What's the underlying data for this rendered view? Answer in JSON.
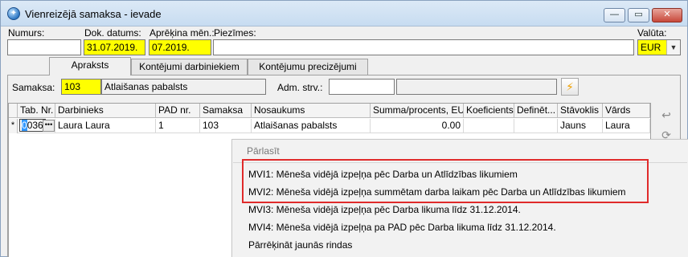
{
  "window": {
    "title": "Vienreizējā samaksa - ievade",
    "controls": {
      "minimize": "—",
      "maximize": "▭",
      "close": "✕"
    }
  },
  "header_fields": {
    "numurs": {
      "label": "Numurs:",
      "value": ""
    },
    "dok_datums": {
      "label": "Dok. datums:",
      "value": "31.07.2019."
    },
    "aprekina_men": {
      "label": "Aprēķina mēn.:",
      "value": "07.2019."
    },
    "piezimes": {
      "label": "Piezīmes:",
      "value": ""
    },
    "valuta": {
      "label": "Valūta:",
      "value": "EUR"
    }
  },
  "tabs": [
    {
      "label": "Apraksts",
      "active": true
    },
    {
      "label": "Kontējumi darbiniekiem",
      "active": false
    },
    {
      "label": "Kontējumu precizējumi",
      "active": false
    }
  ],
  "samaksa": {
    "label": "Samaksa:",
    "code": "103",
    "name": "Atlaišanas pabalsts",
    "adm_label": "Adm. strv.:",
    "adm_code": "",
    "adm_name": ""
  },
  "grid": {
    "columns": [
      "Tab. Nr.",
      "Darbinieks",
      "PAD nr.",
      "Samaksa",
      "Nosaukums",
      "Summa/procents, EUR",
      "Koeficients",
      "Definēt...",
      "Stāvoklis",
      "Vārds"
    ],
    "rows": [
      {
        "indicator": "*",
        "tab_nr": "0036",
        "tab_nr_selected": "0",
        "tab_nr_rest": "036",
        "darbinieks": "Laura Laura",
        "pad_nr": "1",
        "samaksa": "103",
        "nosaukums": "Atlaišanas pabalsts",
        "summa": "0.00",
        "koeficients": "",
        "definet": "",
        "stavoklis": "Jauns",
        "vards": "Laura"
      }
    ]
  },
  "context_menu": {
    "header": "Pārlasīt",
    "items": [
      "MVI1: Mēneša vidējā izpeļņa pēc Darba un Atlīdzības likumiem",
      "MVI2: Mēneša vidējā izpeļņa summētam darba laikam pēc Darba un Atlīdzības likumiem",
      "MVI3: Mēneša vidējā izpeļņa pēc Darba likuma līdz 31.12.2014.",
      "MVI4: Mēneša vidējā izpeļņa pa PAD pēc Darba likuma līdz 31.12.2014.",
      "Pārrēķināt jaunās rindas"
    ],
    "highlight_color": "#e02b2b"
  },
  "icons": {
    "app": "app-globe-icon",
    "ellipsis": "ellipsis-icon",
    "lightning": "lightning-icon",
    "side1": "undo-arrow-icon",
    "side2": "refresh-icon",
    "dropdown": "chevron-down-icon"
  },
  "colors": {
    "required_field": "#ffff00",
    "title_bar": "#c7dcf1"
  }
}
